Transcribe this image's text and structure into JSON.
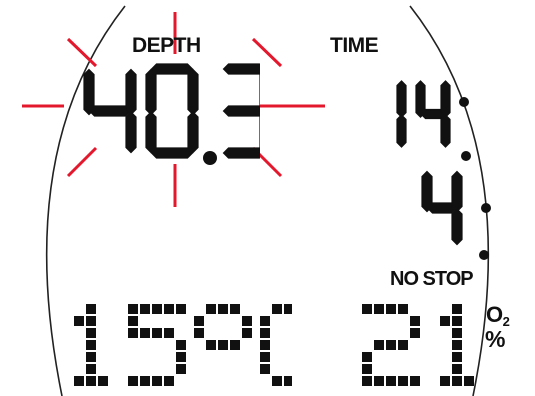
{
  "display": {
    "depth_label": "DEPTH",
    "depth_value": "40.3",
    "depth_alarm": true,
    "time_label": "TIME",
    "time_dive": "14",
    "time_nostop": "4",
    "nostop_label": "NO STOP",
    "temperature_value": "15",
    "temperature_unit": "°C",
    "o2_value": "21",
    "o2_label": "O",
    "o2_subscript": "2",
    "o2_percent": "%"
  },
  "colors": {
    "background": "#ffffff",
    "segment": "#111111",
    "alarm_rays": "#e3182d",
    "bezel": "#222222"
  },
  "icons": {
    "alarm": "flashing-rays-icon",
    "degree": "degree-symbol"
  }
}
